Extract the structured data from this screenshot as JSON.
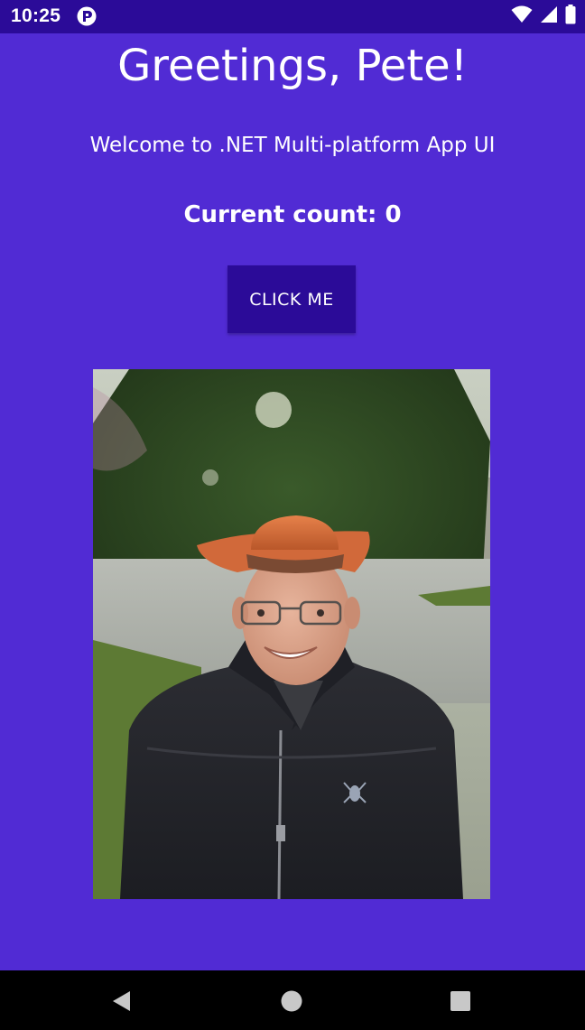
{
  "status_bar": {
    "time": "10:25",
    "app_icon": "notification-app-icon",
    "icons": [
      "wifi-icon",
      "signal-icon",
      "battery-icon"
    ]
  },
  "main": {
    "greeting": "Greetings, Pete!",
    "welcome": "Welcome to .NET Multi-platform App UI",
    "counter": "Current count: 0",
    "button_label": "CLICK ME",
    "photo": "person-in-cowboy-hat-photo"
  },
  "nav_bar": {
    "buttons": [
      "back-icon",
      "home-icon",
      "recents-icon"
    ]
  },
  "colors": {
    "background": "#512BD4",
    "status_bar": "#2B0B98",
    "button": "#2B0B98",
    "text": "#FFFFFF",
    "nav_bar": "#000000"
  }
}
